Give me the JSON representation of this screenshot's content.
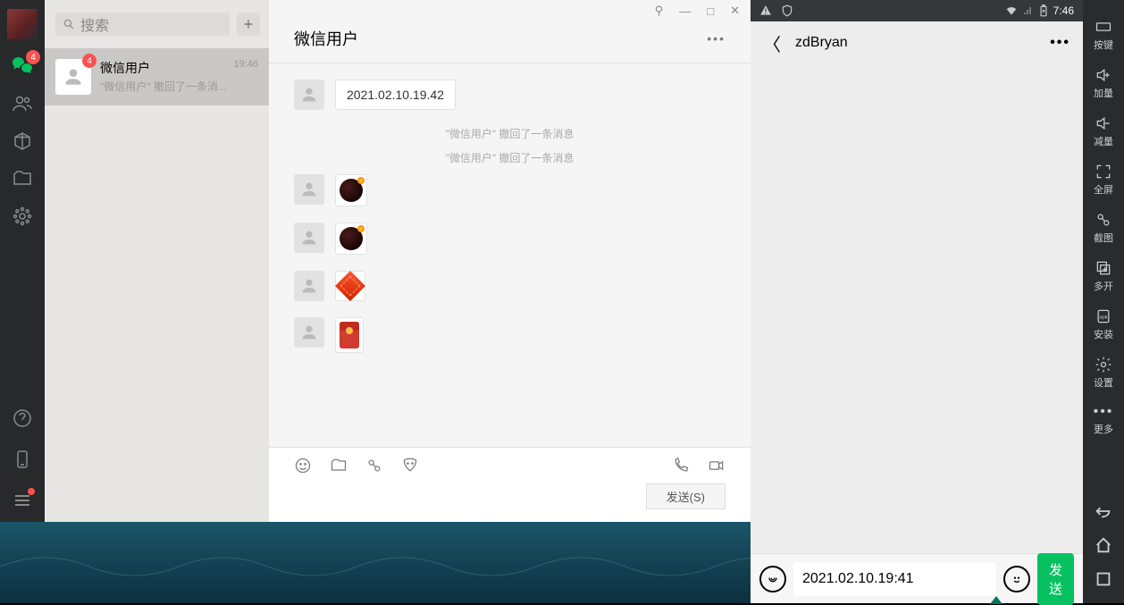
{
  "sidebar": {
    "chat_badge": "4"
  },
  "chatlist": {
    "search_placeholder": "搜索",
    "items": [
      {
        "name": "微信用户",
        "preview": "\"微信用户\" 撤回了一条消...",
        "time": "19:46",
        "badge": "4"
      }
    ]
  },
  "chat": {
    "title": "微信用户",
    "messages": {
      "m0_text": "2021.02.10.19.42",
      "sys1": "\"微信用户\" 撤回了一条消息",
      "sys2": "\"微信用户\" 撤回了一条消息"
    },
    "send_label": "发送(S)"
  },
  "window_controls": {
    "pin": "⚲",
    "min": "—",
    "max": "□",
    "close": "✕"
  },
  "phone": {
    "status_time": "7:46",
    "title": "zdBryan",
    "input_value": "2021.02.10.19:41",
    "send_label": "发送"
  },
  "emubar": {
    "keys": "按键",
    "volup": "加量",
    "voldown": "减量",
    "fullscreen": "全屏",
    "screenshot": "截图",
    "multi": "多开",
    "install": "安装",
    "settings": "设置",
    "more": "更多"
  }
}
